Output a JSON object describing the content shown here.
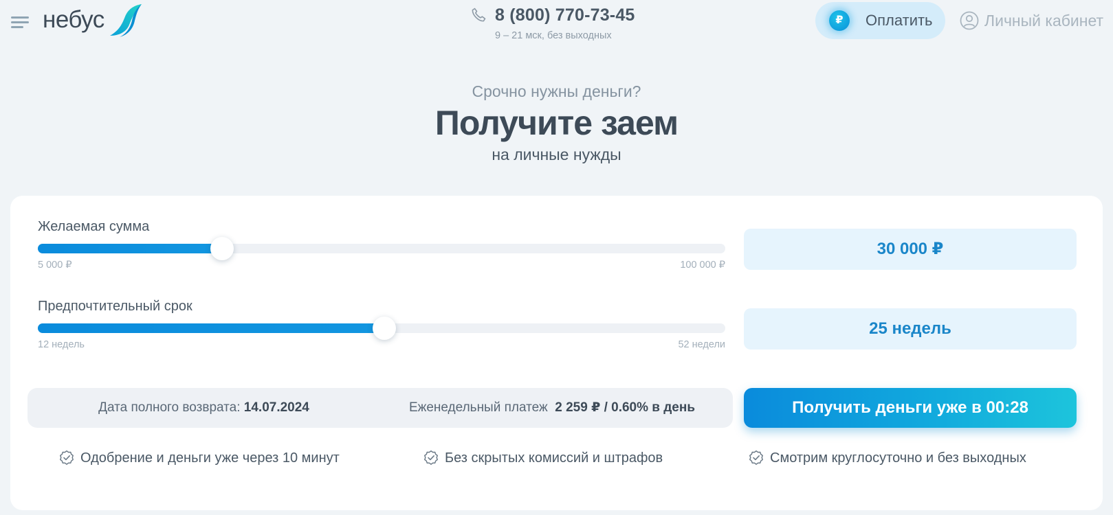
{
  "header": {
    "logo_text": "небус",
    "phone_number": "8 (800) 770-73-45",
    "phone_hours": "9 – 21 мск, без выходных",
    "pay_button": {
      "symbol": "₽",
      "label": "Оплатить"
    },
    "cabinet_label": "Личный кабинет"
  },
  "hero": {
    "subtitle": "Срочно нужны деньги?",
    "title": "Получите заем",
    "note": "на личные нужды"
  },
  "calculator": {
    "amount": {
      "label": "Желаемая сумма",
      "min_label": "5 000 ₽",
      "max_label": "100 000 ₽",
      "value_text": "30 000 ₽",
      "level": 0.268
    },
    "term": {
      "label": "Предпочтительный срок",
      "min_label": "12 недель",
      "max_label": "52 недели",
      "value_text": "25 недель",
      "level": 0.504
    },
    "summary": {
      "return_label": "Дата полного возврата:",
      "return_date": "14.07.2024",
      "payment_label": "Еженедельный платеж",
      "payment_value": "2 259 ₽ / 0.60% в день"
    },
    "cta_label": "Получить деньги уже в 00:28"
  },
  "features": [
    {
      "icon": "check-badge-icon",
      "text": "Одобрение и деньги уже через 10 минут"
    },
    {
      "icon": "check-badge-icon",
      "text": "Без скрытых комиссий и штрафов"
    },
    {
      "icon": "check-badge-icon",
      "text": "Смотрим круглосуточно и без выходных"
    }
  ],
  "colors": {
    "accent": "#0a8bdc",
    "accent_light": "#e6f4fd",
    "background": "#f0f4f7",
    "text": "#3d4a57"
  }
}
